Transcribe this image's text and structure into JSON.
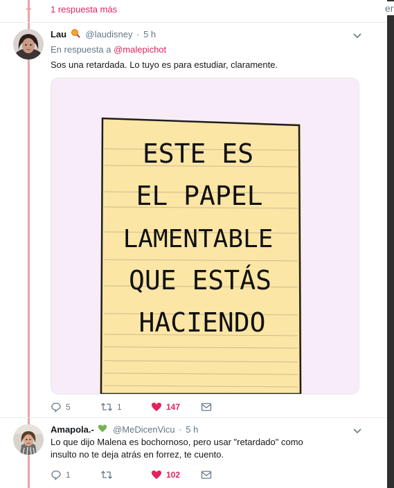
{
  "thread": {
    "more_replies": "1 respuesta más"
  },
  "sidebar_fragment": "er",
  "tweets": [
    {
      "name": "Lau",
      "emoji": "magnifier-emoji",
      "handle": "@laudisney",
      "dot": "·",
      "time": "5 h",
      "reply_prefix": "En respuesta a",
      "reply_handle": "@malepichot",
      "text": "Sos una retardada. Lo tuyo es para estudiar, claramente.",
      "media": {
        "lines": [
          "ESTE ES",
          "EL PAPEL",
          "LAMENTABLE",
          "QUE ESTÁS",
          "HACIENDO"
        ]
      },
      "stats": {
        "replies": "5",
        "retweets": "1",
        "likes": "147"
      }
    },
    {
      "name": "Amapola.-",
      "emoji": "green-heart-emoji",
      "handle": "@MeDicenVicu",
      "dot": "·",
      "time": "5 h",
      "text": "Lo que dijo Malena es bochornoso, pero usar \"retardado\" como insulto no te deja atrás en forrez, te cuento.",
      "stats": {
        "replies": "1",
        "retweets": "",
        "likes": "102"
      }
    }
  ],
  "colors": {
    "accent": "#e0245e",
    "thread_line": "#e8a4a6",
    "muted": "#657786",
    "paper": "#fbe6a6",
    "media_bg": "#f7ecf8"
  }
}
